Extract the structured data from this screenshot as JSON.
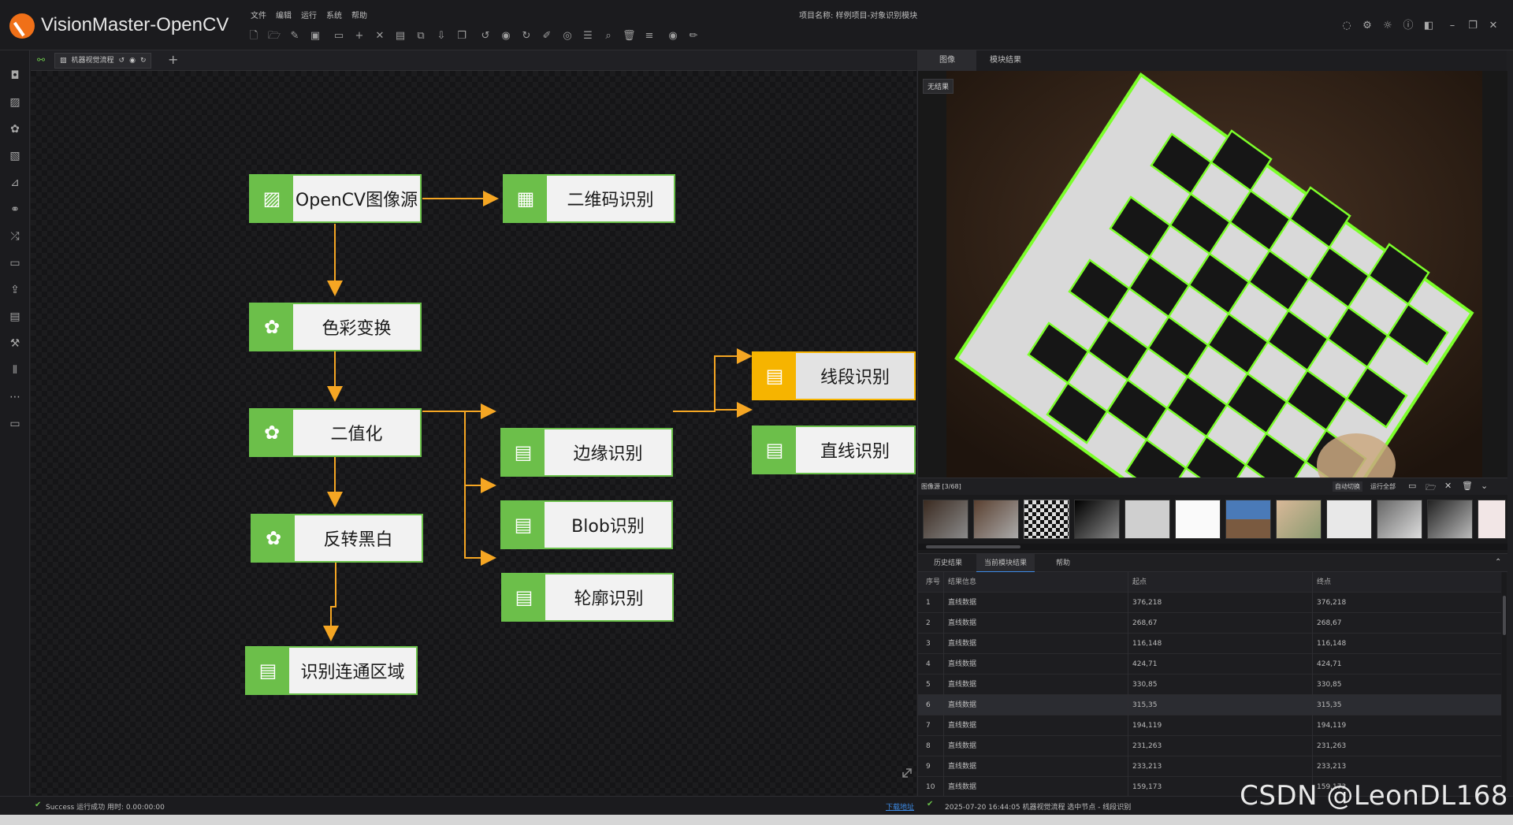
{
  "app": {
    "title": "VisionMaster-OpenCV",
    "project_label": "项目名称:  样例项目-对象识别模块"
  },
  "menu": [
    "文件",
    "编辑",
    "运行",
    "系统",
    "帮助"
  ],
  "canvas_tab": {
    "label": "机器视觉流程"
  },
  "nodes": {
    "source": "OpenCV图像源",
    "qrcode": "二维码识别",
    "color": "色彩变换",
    "binarize": "二值化",
    "invert": "反转黑白",
    "connected": "识别连通区域",
    "edge": "边缘识别",
    "blob": "Blob识别",
    "contour": "轮廓识别",
    "segment": "线段识别",
    "line": "直线识别"
  },
  "right_panel": {
    "tabs": [
      "图像",
      "模块结果"
    ],
    "no_result": "无结果",
    "image_source": "图像源 [3/68]",
    "auto_switch": "自动切换",
    "run_all": "运行全部",
    "result_tabs": [
      "历史结果",
      "当前模块结果",
      "帮助"
    ]
  },
  "table": {
    "headers": [
      "序号",
      "结果信息",
      "起点",
      "终点"
    ],
    "rows": [
      [
        "1",
        "直线数据",
        "376,218",
        "376,218"
      ],
      [
        "2",
        "直线数据",
        "268,67",
        "268,67"
      ],
      [
        "3",
        "直线数据",
        "116,148",
        "116,148"
      ],
      [
        "4",
        "直线数据",
        "424,71",
        "424,71"
      ],
      [
        "5",
        "直线数据",
        "330,85",
        "330,85"
      ],
      [
        "6",
        "直线数据",
        "315,35",
        "315,35"
      ],
      [
        "7",
        "直线数据",
        "194,119",
        "194,119"
      ],
      [
        "8",
        "直线数据",
        "231,263",
        "231,263"
      ],
      [
        "9",
        "直线数据",
        "233,213",
        "233,213"
      ],
      [
        "10",
        "直线数据",
        "159,173",
        "159,173"
      ]
    ]
  },
  "status": {
    "left": "Success 运行成功 用时: 0.00:00:00",
    "link": "下载地址",
    "right": "2025-07-20 16:44:05  机器视觉流程 选中节点 - 线段识别"
  },
  "watermark": "CSDN @LeonDL168",
  "colors": {
    "node_green": "#6cbf4a",
    "selected_yellow": "#f6b400",
    "arrow": "#f5a623",
    "detect_green": "#7cff2a"
  }
}
